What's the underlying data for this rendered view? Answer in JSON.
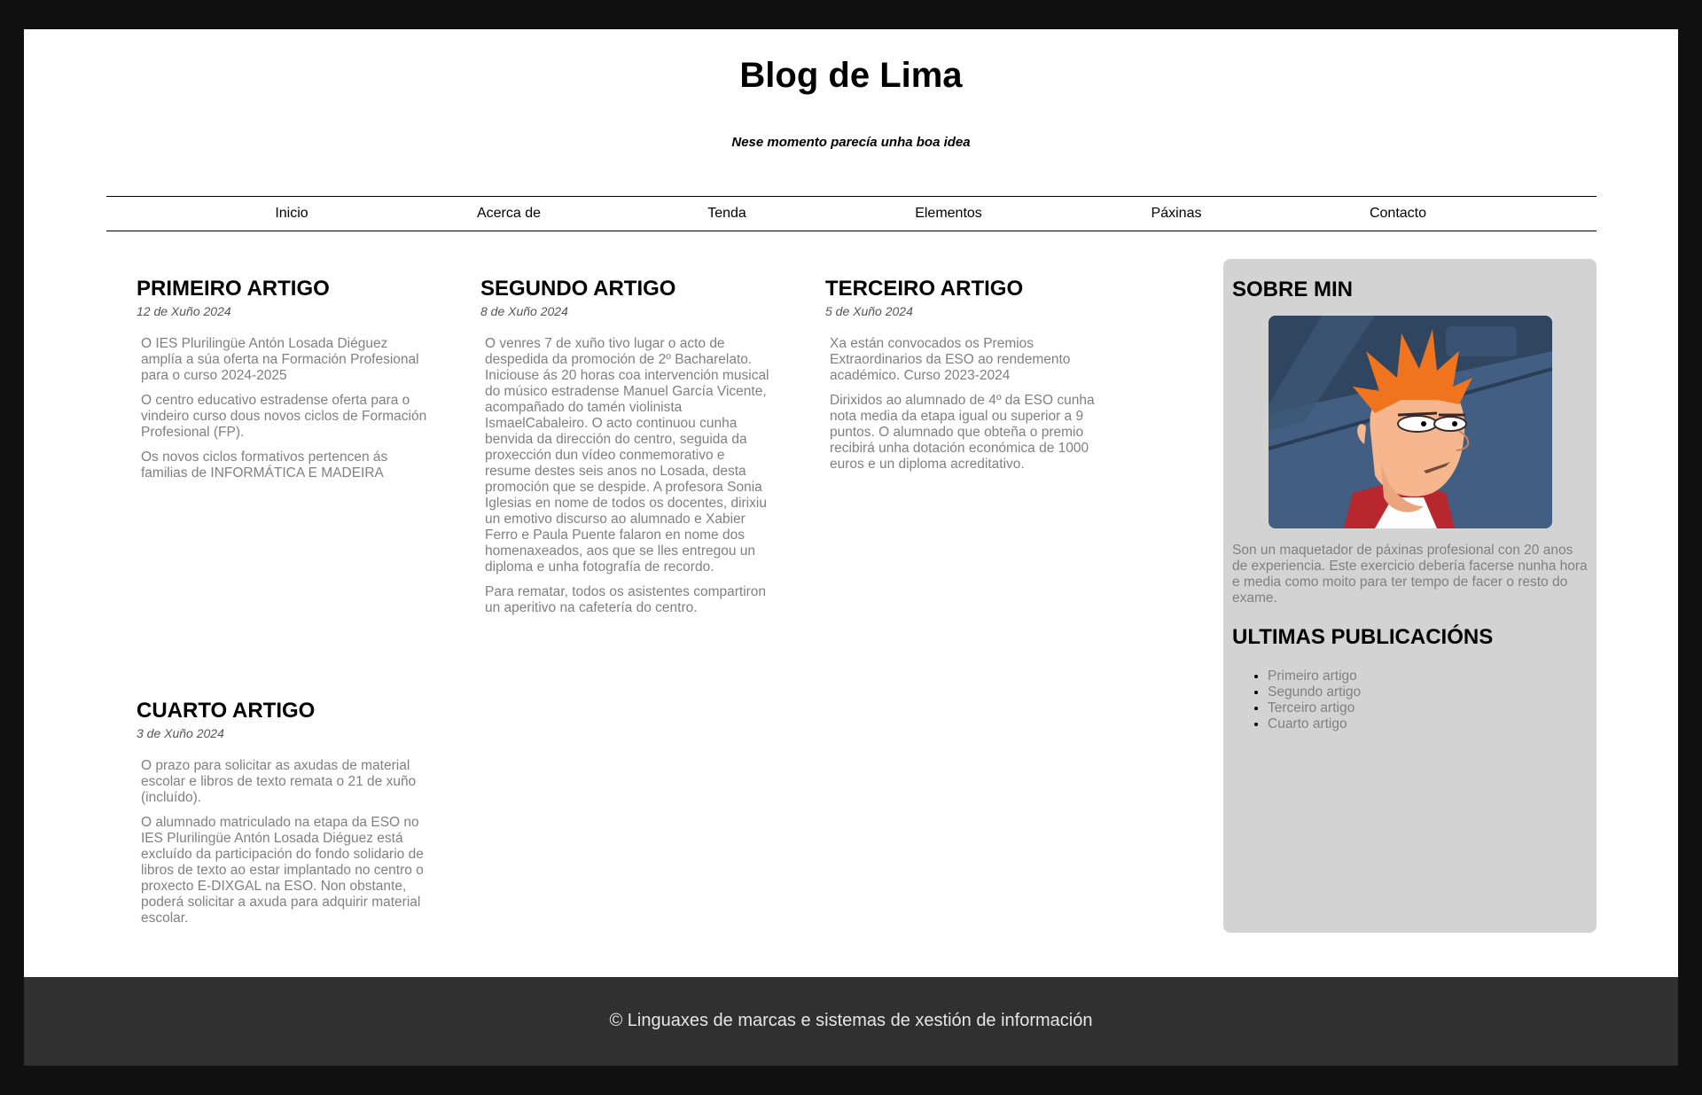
{
  "header": {
    "title": "Blog de Lima",
    "subtitle": "Nese momento parecía unha boa idea"
  },
  "nav": {
    "items": [
      "Inicio",
      "Acerca de",
      "Tenda",
      "Elementos",
      "Páxinas",
      "Contacto"
    ]
  },
  "articles": [
    {
      "title": "PRIMEIRO ARTIGO",
      "date": "12 de Xuño 2024",
      "paragraphs": [
        "O IES Plurilingüe Antón Losada Diéguez amplía a súa oferta na Formación Profesional para o curso 2024-2025",
        "O centro educativo estradense oferta para o vindeiro curso dous novos ciclos de Formación Profesional (FP).",
        "Os novos ciclos formativos pertencen ás familias de INFORMÁTICA E MADEIRA"
      ]
    },
    {
      "title": "SEGUNDO ARTIGO",
      "date": "8 de Xuño 2024",
      "paragraphs": [
        "O venres 7 de xuño tivo lugar o acto de despedida da promoción de 2º Bacharelato. Iniciouse ás 20 horas coa intervención musical do músico estradense Manuel García Vicente, acompañado do tamén violinista IsmaelCabaleiro. O acto continuou cunha benvida da dirección do centro, seguida da proxección dun vídeo conmemorativo e resume destes seis anos no Losada, desta promoción que se despide. A profesora Sonia Iglesias en nome de todos os docentes, dirixiu un emotivo discurso ao alumnado e Xabier Ferro e Paula Puente falaron en nome dos homenaxeados, aos que se lles entregou un diploma e unha fotografía de recordo.",
        "Para rematar, todos os asistentes compartiron un aperitivo na cafetería do centro."
      ]
    },
    {
      "title": "TERCEIRO ARTIGO",
      "date": "5 de Xuño 2024",
      "paragraphs": [
        "Xa están convocados os Premios Extraordinarios da ESO ao rendemento académico. Curso 2023-2024",
        "Dirixidos ao alumnado de 4º da ESO cunha nota media da etapa igual ou superior a 9 puntos. O alumnado que obteña o premio recibirá unha dotación económica de 1000 euros e un diploma acreditativo."
      ]
    },
    {
      "title": "CUARTO ARTIGO",
      "date": "3 de Xuño 2024",
      "paragraphs": [
        "O prazo para solicitar as axudas de material escolar e libros de texto remata o 21 de xuño (incluído).",
        "O alumnado matriculado na etapa da ESO no IES Plurilingüe Antón Losada Diéguez está excluído da participación do fondo solidario de libros de texto ao estar implantado no centro o proxecto E-DIXGAL na ESO. Non obstante, poderá solicitar a axuda para adquirir material escolar."
      ]
    }
  ],
  "sidebar": {
    "about_title": "SOBRE MIN",
    "about_text": "Son un maquetador de páxinas profesional con 20 anos de experiencia. Este exercicio debería facerse nunha hora e media como moito para ter tempo de facer o resto do exame.",
    "recent_title": "ULTIMAS PUBLICACIÓNS",
    "recent": [
      "Primeiro artigo",
      "Segundo artigo",
      "Terceiro artigo",
      "Cuarto artigo"
    ]
  },
  "footer": {
    "text": "© Linguaxes de marcas e sistemas de xestión de información"
  }
}
